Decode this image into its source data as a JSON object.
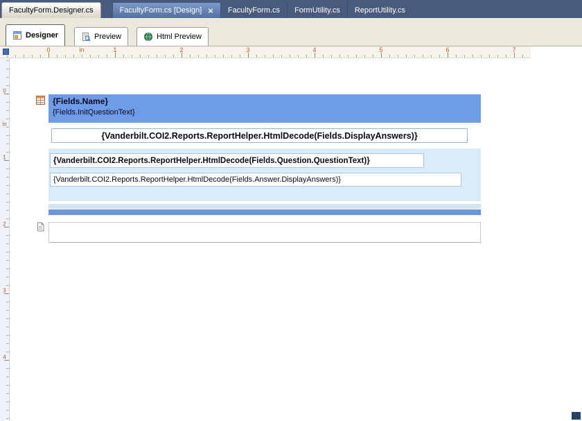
{
  "file_tabs": [
    {
      "label": "FacultyForm.Designer.cs"
    },
    {
      "label": "FacultyForm.cs [Design]",
      "close_glyph": "×"
    },
    {
      "label": "FacultyForm.cs"
    },
    {
      "label": "FormUtility.cs"
    },
    {
      "label": "ReportUtility.cs"
    }
  ],
  "view_tabs": [
    {
      "label": "Designer"
    },
    {
      "label": "Preview"
    },
    {
      "label": "Html Preview"
    }
  ],
  "ruler": {
    "unit": "in",
    "h_labels": [
      {
        "text": "0"
      },
      {
        "text": "in"
      },
      {
        "text": "1"
      },
      {
        "text": "2"
      },
      {
        "text": "3"
      },
      {
        "text": "4"
      },
      {
        "text": "5"
      },
      {
        "text": "6"
      },
      {
        "text": "7"
      }
    ],
    "v_labels": [
      {
        "text": "0"
      },
      {
        "text": "in"
      },
      {
        "text": "1"
      },
      {
        "text": "2"
      },
      {
        "text": "3"
      },
      {
        "text": "4"
      }
    ]
  },
  "report": {
    "group_header": {
      "name_expression": "{Fields.Name}",
      "init_question_expression": "{Fields.InitQuestionText}"
    },
    "display_answers_expression": "{Vanderbilt.COI2.Reports.ReportHelper.HtmlDecode(Fields.DisplayAnswers)}",
    "question_text_expression": "{Vanderbilt.COI2.Reports.ReportHelper.HtmlDecode(Fields.Question.QuestionText)}",
    "answer_display_expression": "{Vanderbilt.COI2.Reports.ReportHelper.HtmlDecode(Fields.Answer.DisplayAnswers)}"
  },
  "colors": {
    "tab_strip_bg": "#485a7d",
    "active_file_tab_bg": "#5b7ab2",
    "view_strip_bg": "#ebe8dc",
    "band_header_bg": "#6f9ce9",
    "panel_bg": "#dcebfa",
    "separator_bar_dark": "#6a96e0",
    "separator_bar_light": "#d3e3f6",
    "ruler_number": "#bc5a1e"
  }
}
